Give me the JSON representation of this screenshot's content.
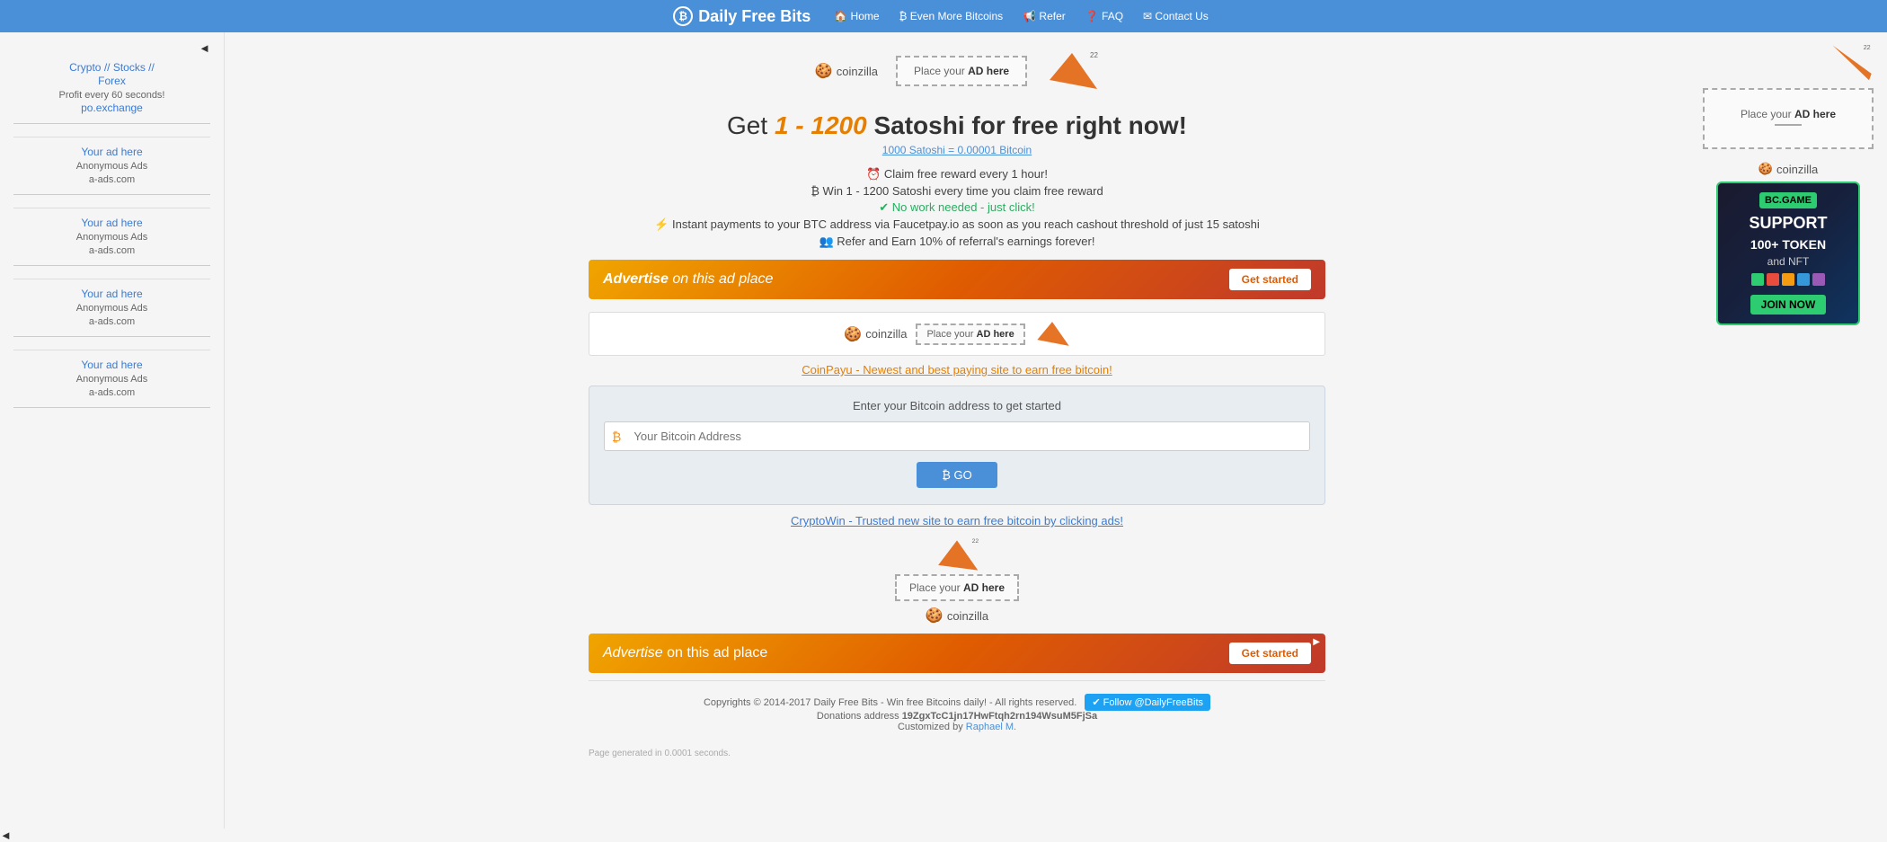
{
  "site": {
    "title": "Daily Free Bits",
    "brand_icon": "₿"
  },
  "navbar": {
    "brand": "Daily Free Bits",
    "links": [
      {
        "label": "🏠 Home",
        "name": "nav-home"
      },
      {
        "label": "₿ Even More Bitcoins",
        "name": "nav-more-bitcoins"
      },
      {
        "label": "📢 Refer",
        "name": "nav-refer"
      },
      {
        "label": "❓ FAQ",
        "name": "nav-faq"
      },
      {
        "label": "✉ Contact Us",
        "name": "nav-contact"
      }
    ]
  },
  "sidebar_left": {
    "ads": [
      {
        "title1": "Crypto // Stocks //",
        "title2": "Forex",
        "subtitle": "Profit every 60 seconds!",
        "link": "po.exchange"
      },
      {
        "label": "Your ad here",
        "sub1": "Anonymous Ads",
        "sub2": "a-ads.com"
      },
      {
        "label": "Your ad here",
        "sub1": "Anonymous Ads",
        "sub2": "a-ads.com"
      },
      {
        "label": "Your ad here",
        "sub1": "Anonymous Ads",
        "sub2": "a-ads.com"
      },
      {
        "label": "Your ad here",
        "sub1": "Anonymous Ads",
        "sub2": "a-ads.com"
      }
    ],
    "red_tab_label": "◄"
  },
  "main": {
    "coinzilla_label": "coinzilla",
    "place_ad_line1": "Place your",
    "place_ad_line2": "AD here",
    "heading_prefix": "Get",
    "heading_range": "1 - 1200",
    "heading_suffix": "Satoshi for free right now!",
    "sub_link": "1000 Satoshi = 0.00001 Bitcoin",
    "features": [
      "⏰ Claim free reward every 1 hour!",
      "₿ Win 1 - 1200 Satoshi every time you claim free reward",
      "✔ No work needed - just click!",
      "⚡ Instant payments to your BTC address via Faucetpay.io as soon as you reach cashout threshold of just 15 satoshi",
      "👥 Refer and Earn 10% of referral's earnings forever!"
    ],
    "advertise_text_pre": "Advertise",
    "advertise_on": "on this ad place",
    "advertise_btn": "Get started",
    "coinpayu_link": "CoinPayu - Newest and best paying site to earn free bitcoin!",
    "input_label": "Enter your Bitcoin address to get started",
    "input_placeholder": "Your Bitcoin Address",
    "go_btn": "₿ GO",
    "cryptowin_link": "CryptoWin - Trusted new site to earn free bitcoin by clicking ads!",
    "place_ad2_line1": "Place your",
    "place_ad2_line2": "AD here",
    "coinzilla2_label": "coinzilla"
  },
  "advertise_banner2": {
    "text_pre": "Advertise",
    "text_on": "on this ad place",
    "btn": "Get started"
  },
  "footer": {
    "copyright": "Copyrights © 2014-2017 Daily Free Bits - Win free Bitcoins daily! - All rights reserved.",
    "twitter_label": "✔ Follow @DailyFreeBits",
    "donations_label": "Donations address",
    "donations_address": "19ZgxTcC1jn17HwFtqh2rn194WsuM5FjSa",
    "customized_by": "Customized by",
    "customizer": "Raphael M."
  },
  "sidebar_right": {
    "place_ad_line1": "Place your",
    "place_ad_line2": "AD here",
    "coinzilla_label": "coinzilla",
    "bc_game": {
      "header": "BC.GAME",
      "support": "SUPPORT",
      "tokens": "100+ TOKEN",
      "and_nft": "and NFT",
      "join": "JOIN NOW"
    }
  },
  "page_gen": "Page generated in 0.0001 seconds."
}
